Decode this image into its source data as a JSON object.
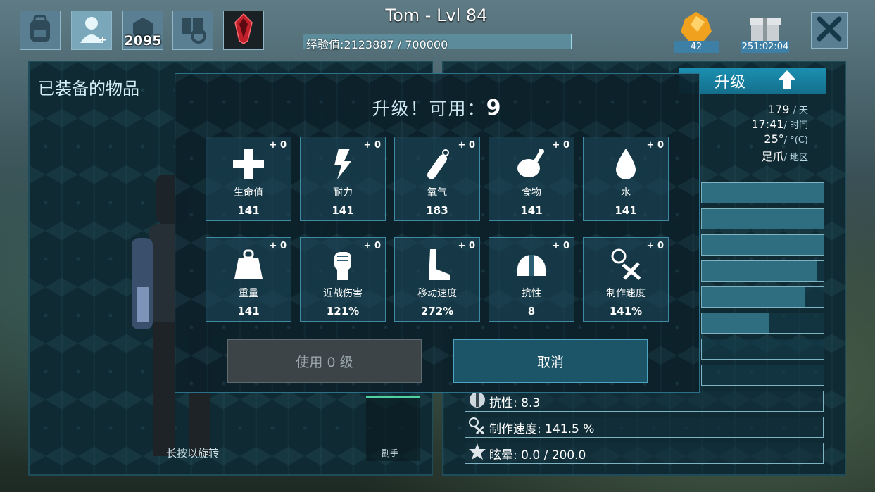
{
  "topbar": {
    "icons": [
      {
        "name": "inventory-backpack-icon"
      },
      {
        "name": "character-profile-icon"
      },
      {
        "name": "engrams-icon",
        "count": "2095"
      },
      {
        "name": "crafting-settings-icon"
      },
      {
        "name": "tribe-crystal-icon"
      }
    ],
    "title": "Tom - Lvl 84",
    "xp_text": "经验值:2123887 / 700000",
    "xp_fraction": 1.0,
    "amber_count": "42",
    "gift_timer": "251:02:04"
  },
  "left_panel": {
    "heading": "已装备的物品",
    "rotate_hint": "长按以旋转",
    "offhand_label": "副手"
  },
  "right_panel": {
    "levelup_label": "升级",
    "info": {
      "day": "179",
      "day_unit": "/ 天",
      "time": "17:41",
      "time_unit": "/ 时间",
      "temp": "25°",
      "temp_unit": "/ °(C)",
      "region": "足爪",
      "region_unit": "/ 地区"
    },
    "bar_fills": [
      1.0,
      1.0,
      1.0,
      0.95,
      0.85,
      0.55,
      0.0,
      0.0,
      0.0
    ],
    "stat_rows": [
      {
        "icon": "shield-icon",
        "text": "抗性: 8.3"
      },
      {
        "icon": "crafting-icon",
        "text": "制作速度: 141.5 %"
      },
      {
        "icon": "stun-icon",
        "text": "眩晕: 0.0 / 200.0"
      }
    ]
  },
  "modal": {
    "title_prefix": "升级！可用：",
    "points": "9",
    "stats": [
      {
        "id": "health",
        "icon": "health-cross-icon",
        "label": "生命值",
        "value": "141",
        "bonus": "+ 0"
      },
      {
        "id": "stamina",
        "icon": "stamina-bolt-icon",
        "label": "耐力",
        "value": "141",
        "bonus": "+ 0"
      },
      {
        "id": "oxygen",
        "icon": "oxygen-tank-icon",
        "label": "氧气",
        "value": "183",
        "bonus": "+ 0"
      },
      {
        "id": "food",
        "icon": "food-meat-icon",
        "label": "食物",
        "value": "141",
        "bonus": "+ 0"
      },
      {
        "id": "water",
        "icon": "water-drop-icon",
        "label": "水",
        "value": "141",
        "bonus": "+ 0"
      },
      {
        "id": "weight",
        "icon": "weight-icon",
        "label": "重量",
        "value": "141",
        "bonus": "+ 0"
      },
      {
        "id": "melee",
        "icon": "melee-fist-icon",
        "label": "近战伤害",
        "value": "121%",
        "bonus": "+ 0"
      },
      {
        "id": "speed",
        "icon": "movement-foot-icon",
        "label": "移动速度",
        "value": "272%",
        "bonus": "+ 0"
      },
      {
        "id": "fortitude",
        "icon": "fortitude-helmet-icon",
        "label": "抗性",
        "value": "8",
        "bonus": "+ 0"
      },
      {
        "id": "crafting",
        "icon": "crafting-speed-icon",
        "label": "制作速度",
        "value": "141%",
        "bonus": "+ 0"
      }
    ],
    "use_button": "使用 0 级",
    "cancel_button": "取消"
  }
}
